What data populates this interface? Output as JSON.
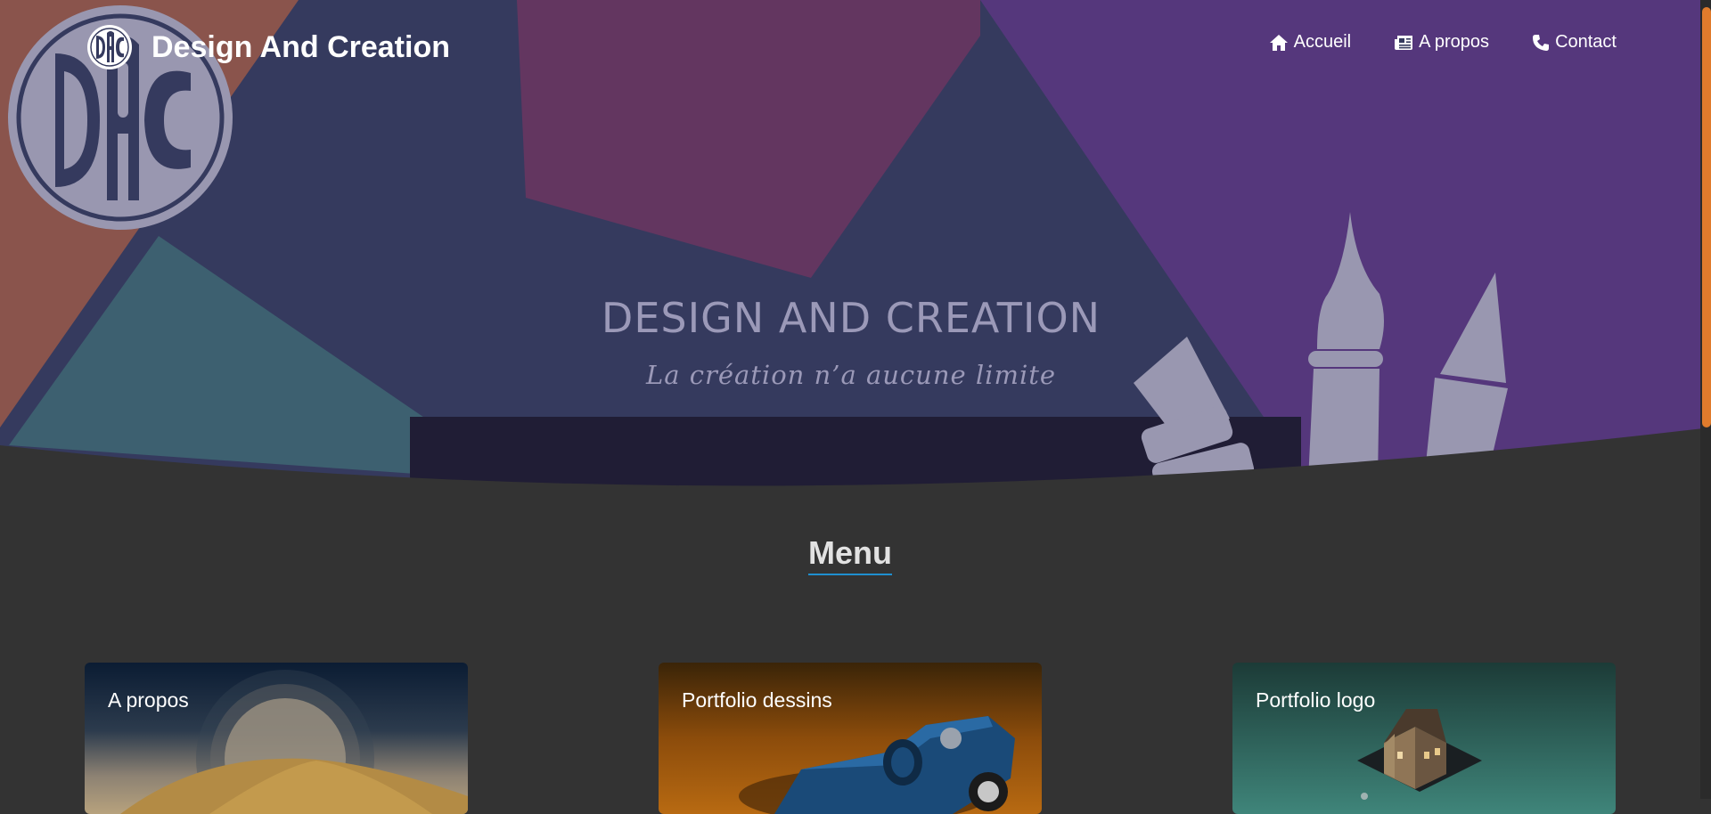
{
  "header": {
    "brand_name": "Design And Creation",
    "brand_logo_text": "DAC",
    "nav": [
      {
        "label": "Accueil",
        "icon": "home-icon"
      },
      {
        "label": "A propos",
        "icon": "newspaper-icon"
      },
      {
        "label": "Contact",
        "icon": "phone-icon"
      }
    ]
  },
  "hero": {
    "logo_text": "DAC",
    "title": "DESIGN AND CREATION",
    "subtitle": "La création n’a aucune limite"
  },
  "menu": {
    "title": "Menu",
    "cards": [
      {
        "title": "A propos",
        "image": "desert-moon-illustration"
      },
      {
        "title": "Portfolio dessins",
        "image": "blue-race-car-illustration"
      },
      {
        "title": "Portfolio logo",
        "image": "isometric-house-illustration"
      }
    ]
  },
  "colors": {
    "background": "#333333",
    "accent_underline": "#1f8fd0",
    "scrollbar": "#e07b2c",
    "hero_navy": "#353a5e",
    "hero_purple": "#55377c",
    "hero_pink": "#633660",
    "hero_rust": "#8a544c",
    "hero_teal": "#3d6070",
    "hero_text": "#9b99b8"
  }
}
